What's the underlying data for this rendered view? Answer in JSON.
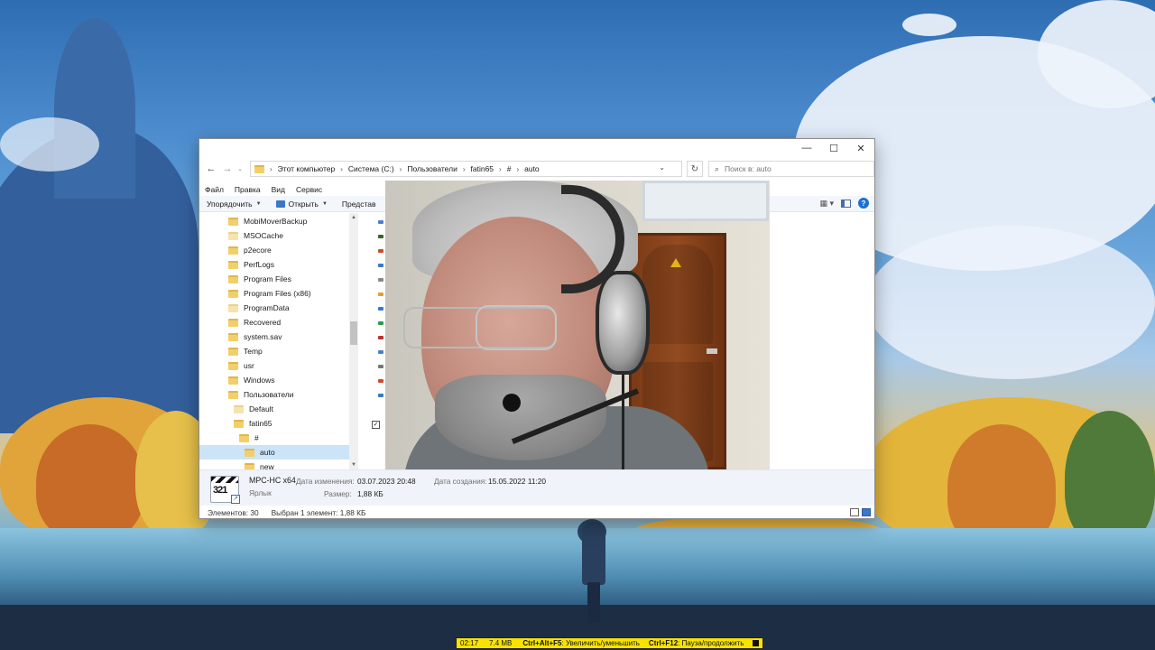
{
  "explorer": {
    "address": {
      "crumbs": [
        "Этот компьютер",
        "Система (C:)",
        "Пользователи",
        "fatin65",
        "#",
        "auto"
      ]
    },
    "search_placeholder": "Поиск в: auto",
    "menu": [
      "Файл",
      "Правка",
      "Вид",
      "Сервис"
    ],
    "toolbar": {
      "organize": "Упорядочить",
      "open": "Открыть",
      "present": "Представ"
    },
    "tree": [
      {
        "label": "MobiMoverBackup"
      },
      {
        "label": "MSOCache"
      },
      {
        "label": "p2ecore"
      },
      {
        "label": "PerfLogs"
      },
      {
        "label": "Program Files"
      },
      {
        "label": "Program Files (x86)"
      },
      {
        "label": "ProgramData"
      },
      {
        "label": "Recovered"
      },
      {
        "label": "system.sav"
      },
      {
        "label": "Temp"
      },
      {
        "label": "usr"
      },
      {
        "label": "Windows"
      },
      {
        "label": "Пользователи"
      },
      {
        "label": "Default"
      },
      {
        "label": "fatin65"
      },
      {
        "label": "#"
      },
      {
        "label": "auto"
      },
      {
        "label": "new"
      }
    ],
    "details": {
      "name": "MPC-HC x64",
      "type": "Ярлык",
      "modified_label": "Дата изменения:",
      "modified_value": "03.07.2023 20:48",
      "size_label": "Размер:",
      "size_value": "1,88 КБ",
      "created_label": "Дата создания:",
      "created_value": "15.05.2022 11:20",
      "icon_text": "321"
    },
    "status": {
      "items_count": "Элементов: 30",
      "selected": "Выбран 1 элемент: 1,88 КБ"
    }
  },
  "recorder": {
    "time": "02:17",
    "size": "7.4 MB",
    "hotkey1": "Ctrl+Alt+F5",
    "hotkey1_desc": ": Увеличить/уменьшить",
    "hotkey2": "Ctrl+F12",
    "hotkey2_desc": ": Пауза/продолжить"
  },
  "colors": {
    "accent": "#1e6fd1",
    "selection": "#cce4f7",
    "recorder_bar": "#f7e300",
    "folder": "#f2cf6a"
  }
}
